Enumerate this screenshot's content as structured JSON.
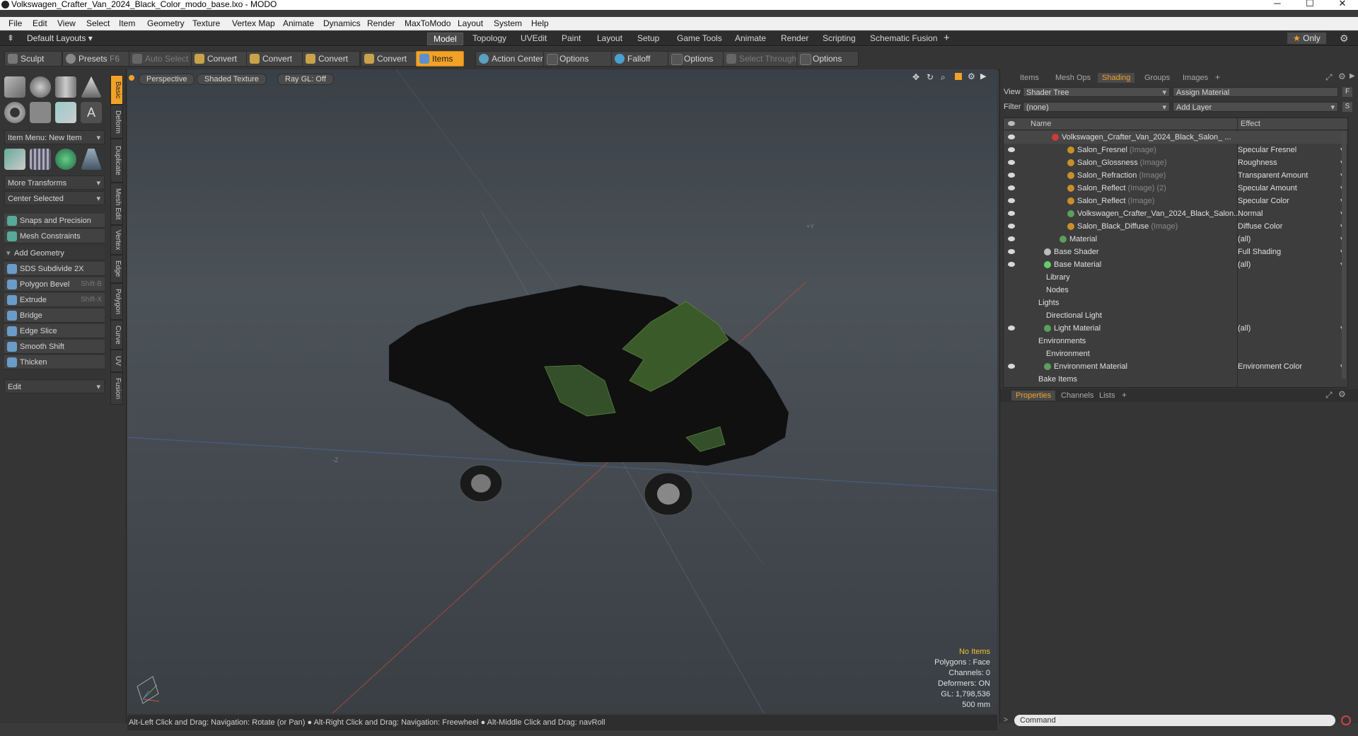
{
  "window": {
    "title": "Volkswagen_Crafter_Van_2024_Black_Color_modo_base.lxo - MODO"
  },
  "menu": [
    "File",
    "Edit",
    "View",
    "Select",
    "Item",
    "Geometry",
    "Texture",
    "Vertex Map",
    "Animate",
    "Dynamics",
    "Render",
    "MaxToModo",
    "Layout",
    "System",
    "Help"
  ],
  "layoutbar": {
    "layouts_label": "Default Layouts",
    "tabs": [
      "Model",
      "Topology",
      "UVEdit",
      "Paint",
      "Layout",
      "Setup",
      "Game Tools",
      "Animate",
      "Render",
      "Scripting",
      "Schematic Fusion"
    ],
    "active_tab": "Model",
    "only_label": "Only"
  },
  "toolbar": {
    "sculpt": "Sculpt",
    "presets": "Presets",
    "presets_key": "F6",
    "auto_select": "Auto Select",
    "convert": "Convert",
    "items": "Items",
    "action_center": "Action Center",
    "options": "Options",
    "falloff": "Falloff",
    "select_through": "Select Through"
  },
  "leftpanel": {
    "item_menu": "Item Menu: New Item",
    "more_transforms": "More Transforms",
    "center_selected": "Center Selected",
    "snaps": "Snaps and Precision",
    "mesh_constraints": "Mesh Constraints",
    "add_geometry": "Add Geometry",
    "tools": [
      {
        "label": "SDS Subdivide 2X",
        "shortcut": ""
      },
      {
        "label": "Polygon Bevel",
        "shortcut": "Shift-B"
      },
      {
        "label": "Extrude",
        "shortcut": "Shift-X"
      },
      {
        "label": "Bridge",
        "shortcut": ""
      },
      {
        "label": "Edge Slice",
        "shortcut": ""
      },
      {
        "label": "Smooth Shift",
        "shortcut": ""
      },
      {
        "label": "Thicken",
        "shortcut": ""
      }
    ],
    "edit": "Edit",
    "vtabs": [
      "Basic",
      "Deform",
      "Duplicate",
      "Mesh Edit",
      "Vertex",
      "Edge",
      "Polygon",
      "Curve",
      "UV",
      "Fusion"
    ]
  },
  "viewport": {
    "perspective": "Perspective",
    "shading": "Shaded Texture",
    "raygl": "Ray GL: Off",
    "stats": {
      "no_items": "No Items",
      "polygons": "Polygons : Face",
      "channels": "Channels: 0",
      "deformers": "Deformers: ON",
      "gl": "GL: 1,798,536",
      "scale": "500 mm"
    }
  },
  "statusbar": {
    "text": "Alt-Left Click and Drag: Navigation: Rotate (or Pan) ● Alt-Right Click and Drag: Navigation: Freewheel ● Alt-Middle Click and Drag: navRoll"
  },
  "rightpanel": {
    "tabs": [
      "Items",
      "Mesh Ops",
      "Shading",
      "Groups",
      "Images"
    ],
    "active_tab": "Shading",
    "view_label": "View",
    "view_value": "Shader Tree",
    "assign_material": "Assign Material",
    "filter_label": "Filter",
    "filter_value": "(none)",
    "add_layer": "Add Layer",
    "col_name": "Name",
    "col_effect": "Effect",
    "rows": [
      {
        "name": "Volkswagen_Crafter_Van_2024_Black_Salon_ ...",
        "sub": "",
        "effect": "",
        "indent": 4
      },
      {
        "name": "Salon_Fresnel",
        "sub": "(Image)",
        "effect": "Specular Fresnel",
        "indent": 6
      },
      {
        "name": "Salon_Glossness",
        "sub": "(Image)",
        "effect": "Roughness",
        "indent": 6
      },
      {
        "name": "Salon_Refraction",
        "sub": "(Image)",
        "effect": "Transparent Amount",
        "indent": 6
      },
      {
        "name": "Salon_Reflect",
        "sub": "(Image) (2)",
        "effect": "Specular Amount",
        "indent": 6
      },
      {
        "name": "Salon_Reflect",
        "sub": "(Image)",
        "effect": "Specular Color",
        "indent": 6
      },
      {
        "name": "Volkswagen_Crafter_Van_2024_Black_Salon...",
        "sub": "",
        "effect": "Normal",
        "indent": 6
      },
      {
        "name": "Salon_Black_Diffuse",
        "sub": "(Image)",
        "effect": "Diffuse Color",
        "indent": 6
      },
      {
        "name": "Material",
        "sub": "",
        "effect": "(all)",
        "indent": 5
      },
      {
        "name": "Base Shader",
        "sub": "",
        "effect": "Full Shading",
        "indent": 3
      },
      {
        "name": "Base Material",
        "sub": "",
        "effect": "(all)",
        "indent": 3
      },
      {
        "name": "Library",
        "sub": "",
        "effect": "",
        "indent": 2
      },
      {
        "name": "Nodes",
        "sub": "",
        "effect": "",
        "indent": 2
      },
      {
        "name": "Lights",
        "sub": "",
        "effect": "",
        "indent": 1
      },
      {
        "name": "Directional Light",
        "sub": "",
        "effect": "",
        "indent": 2
      },
      {
        "name": "Light Material",
        "sub": "",
        "effect": "(all)",
        "indent": 3
      },
      {
        "name": "Environments",
        "sub": "",
        "effect": "",
        "indent": 1
      },
      {
        "name": "Environment",
        "sub": "",
        "effect": "",
        "indent": 2
      },
      {
        "name": "Environment Material",
        "sub": "",
        "effect": "Environment Color",
        "indent": 3
      },
      {
        "name": "Bake Items",
        "sub": "",
        "effect": "",
        "indent": 1
      }
    ],
    "props_tabs": [
      "Properties",
      "Channels",
      "Lists"
    ],
    "command_placeholder": "Command"
  },
  "colors": {
    "accent": "#f2a227",
    "viewport_top": "#3a4047"
  }
}
